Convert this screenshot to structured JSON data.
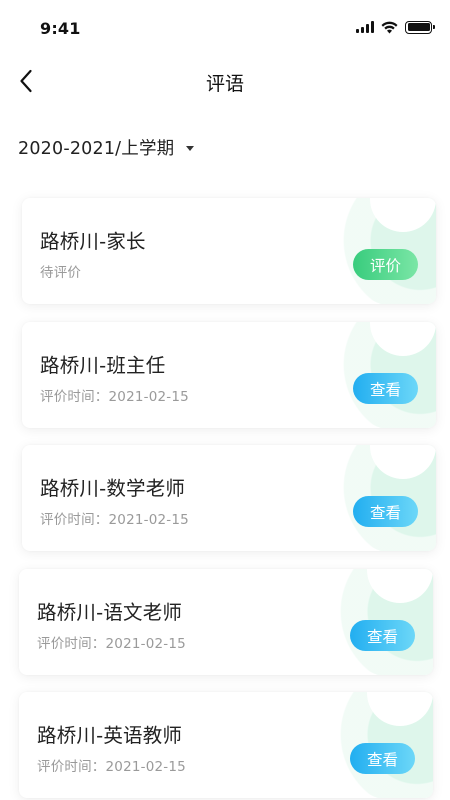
{
  "status_bar": {
    "time": "9:41"
  },
  "nav": {
    "title": "评语"
  },
  "term": {
    "label": "2020-2021/上学期"
  },
  "cards": [
    {
      "title": "路桥川-家长",
      "subtitle": "待评价",
      "button": "评价",
      "button_color": "#38cc7d"
    },
    {
      "title": "路桥川-班主任",
      "subtitle": "评价时间：2021-02-15",
      "button": "查看",
      "button_color": "#22aef0"
    },
    {
      "title": "路桥川-数学老师",
      "subtitle": "评价时间：2021-02-15",
      "button": "查看",
      "button_color": "#22aef0"
    },
    {
      "title": "路桥川-语文老师",
      "subtitle": "评价时间：2021-02-15",
      "button": "查看",
      "button_color": "#22aef0"
    },
    {
      "title": "路桥川-英语教师",
      "subtitle": "评价时间：2021-02-15",
      "button": "查看",
      "button_color": "#22aef0"
    }
  ]
}
